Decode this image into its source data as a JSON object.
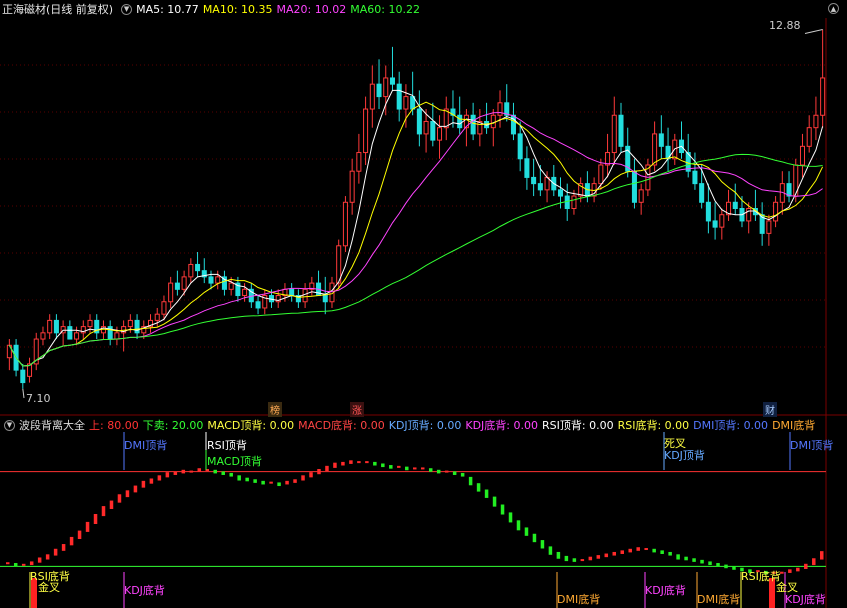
{
  "header": {
    "title": "正海磁材(日线 前复权)",
    "ma_items": [
      {
        "label": "MA5: 10.77",
        "color": "#ffffff"
      },
      {
        "label": "MA10: 10.35",
        "color": "#ffff00"
      },
      {
        "label": "MA20: 10.02",
        "color": "#ff44ff"
      },
      {
        "label": "MA60: 10.22",
        "color": "#33ff33"
      }
    ]
  },
  "price_panel": {
    "high_label": "12.88",
    "low_label": "7.10",
    "event_tags": [
      {
        "text": "榜",
        "color": "#ffaa55"
      },
      {
        "text": "涨",
        "color": "#ff5555"
      },
      {
        "text": "财",
        "color": "#aaccff"
      }
    ]
  },
  "indicator_header": {
    "name": "波段背离大全",
    "items": [
      {
        "label": "上: 80.00",
        "color": "#ff3333"
      },
      {
        "label": "下卖: 20.00",
        "color": "#33ff33"
      },
      {
        "label": "MACD顶背: 0.00",
        "color": "#ffff44"
      },
      {
        "label": "MACD底背: 0.00",
        "color": "#ff4444"
      },
      {
        "label": "KDJ顶背: 0.00",
        "color": "#66aaff"
      },
      {
        "label": "KDJ底背: 0.00",
        "color": "#ff44ff"
      },
      {
        "label": "RSI顶背: 0.00",
        "color": "#ffffff"
      },
      {
        "label": "RSI底背: 0.00",
        "color": "#ffff44"
      },
      {
        "label": "DMI顶背: 0.00",
        "color": "#5577ff"
      },
      {
        "label": "DMI底背",
        "color": "#ffaa33"
      }
    ]
  },
  "signals": {
    "dmi_top_1": "DMI顶背",
    "rsi_top": "RSI顶背",
    "macd_top": "MACD顶背",
    "dead_cross": "死叉",
    "kdj_top": "KDJ顶背",
    "dmi_top_2": "DMI顶背",
    "rsi_bottom_1": "RSI底背",
    "golden_cross_1": "金叉",
    "kdj_bottom_1": "KDJ底背",
    "dmi_bottom_1": "DMI底背",
    "kdj_bottom_2": "KDJ底背",
    "dmi_bottom_2": "DMI底背",
    "rsi_bottom_2": "RSI底背",
    "golden_cross_2": "金叉",
    "kdj_bottom_3": "KDJ底背"
  },
  "chart_data": {
    "type": "candlestick",
    "candles_ohlc": [
      [
        7.6,
        7.9,
        7.4,
        7.8
      ],
      [
        7.8,
        7.9,
        7.3,
        7.4
      ],
      [
        7.4,
        7.5,
        7.1,
        7.2
      ],
      [
        7.3,
        7.6,
        7.2,
        7.5
      ],
      [
        7.5,
        8.0,
        7.4,
        7.9
      ],
      [
        7.9,
        8.1,
        7.8,
        8.0
      ],
      [
        8.0,
        8.3,
        7.9,
        8.2
      ],
      [
        8.2,
        8.3,
        7.9,
        8.0
      ],
      [
        8.0,
        8.2,
        7.8,
        8.1
      ],
      [
        8.1,
        8.2,
        7.9,
        7.9
      ],
      [
        7.9,
        8.1,
        7.8,
        8.0
      ],
      [
        8.0,
        8.2,
        7.9,
        8.1
      ],
      [
        8.1,
        8.3,
        8.0,
        8.2
      ],
      [
        8.2,
        8.3,
        7.9,
        8.0
      ],
      [
        8.0,
        8.2,
        7.9,
        8.1
      ],
      [
        8.1,
        8.2,
        7.8,
        7.9
      ],
      [
        7.9,
        8.1,
        7.8,
        8.0
      ],
      [
        8.0,
        8.2,
        7.7,
        8.1
      ],
      [
        8.1,
        8.3,
        8.0,
        8.2
      ],
      [
        8.2,
        8.3,
        7.9,
        8.0
      ],
      [
        8.0,
        8.2,
        7.9,
        8.1
      ],
      [
        8.1,
        8.3,
        8.0,
        8.2
      ],
      [
        8.2,
        8.4,
        8.1,
        8.3
      ],
      [
        8.3,
        8.6,
        8.2,
        8.5
      ],
      [
        8.5,
        8.9,
        8.4,
        8.8
      ],
      [
        8.8,
        9.0,
        8.6,
        8.7
      ],
      [
        8.7,
        9.0,
        8.6,
        8.9
      ],
      [
        8.9,
        9.2,
        8.8,
        9.1
      ],
      [
        9.1,
        9.3,
        8.9,
        9.0
      ],
      [
        9.0,
        9.2,
        8.8,
        8.9
      ],
      [
        8.9,
        9.0,
        8.7,
        8.8
      ],
      [
        8.8,
        9.0,
        8.7,
        8.9
      ],
      [
        8.9,
        9.0,
        8.6,
        8.7
      ],
      [
        8.7,
        8.9,
        8.6,
        8.8
      ],
      [
        8.8,
        8.9,
        8.5,
        8.6
      ],
      [
        8.6,
        8.8,
        8.5,
        8.7
      ],
      [
        8.7,
        8.8,
        8.4,
        8.5
      ],
      [
        8.5,
        8.6,
        8.3,
        8.4
      ],
      [
        8.4,
        8.7,
        8.3,
        8.6
      ],
      [
        8.6,
        8.7,
        8.4,
        8.5
      ],
      [
        8.5,
        8.7,
        8.4,
        8.6
      ],
      [
        8.6,
        8.8,
        8.5,
        8.7
      ],
      [
        8.7,
        8.8,
        8.5,
        8.6
      ],
      [
        8.6,
        8.7,
        8.4,
        8.5
      ],
      [
        8.5,
        8.8,
        8.4,
        8.7
      ],
      [
        8.7,
        8.9,
        8.6,
        8.8
      ],
      [
        8.8,
        9.0,
        8.7,
        8.6
      ],
      [
        8.6,
        8.9,
        8.3,
        8.5
      ],
      [
        8.5,
        8.9,
        8.4,
        8.8
      ],
      [
        8.8,
        9.5,
        8.7,
        9.4
      ],
      [
        9.4,
        10.2,
        9.3,
        10.1
      ],
      [
        10.1,
        10.8,
        9.9,
        10.6
      ],
      [
        10.6,
        11.2,
        10.4,
        10.9
      ],
      [
        10.9,
        11.8,
        10.7,
        11.6
      ],
      [
        11.6,
        12.3,
        11.3,
        12.0
      ],
      [
        12.0,
        12.4,
        11.6,
        11.8
      ],
      [
        11.8,
        12.3,
        11.5,
        12.1
      ],
      [
        12.1,
        12.6,
        11.9,
        12.0
      ],
      [
        12.0,
        12.2,
        11.4,
        11.6
      ],
      [
        11.6,
        12.0,
        11.3,
        11.8
      ],
      [
        11.8,
        12.2,
        11.5,
        11.6
      ],
      [
        11.6,
        11.9,
        11.0,
        11.2
      ],
      [
        11.2,
        11.6,
        10.9,
        11.4
      ],
      [
        11.4,
        11.7,
        11.0,
        11.1
      ],
      [
        11.1,
        11.5,
        10.8,
        11.3
      ],
      [
        11.3,
        11.8,
        11.1,
        11.6
      ],
      [
        11.6,
        11.9,
        11.3,
        11.5
      ],
      [
        11.5,
        11.8,
        11.2,
        11.3
      ],
      [
        11.3,
        11.6,
        11.0,
        11.5
      ],
      [
        11.5,
        11.7,
        11.1,
        11.2
      ],
      [
        11.2,
        11.6,
        11.0,
        11.4
      ],
      [
        11.4,
        11.7,
        11.2,
        11.3
      ],
      [
        11.3,
        11.6,
        11.0,
        11.5
      ],
      [
        11.5,
        11.9,
        11.3,
        11.7
      ],
      [
        11.7,
        12.0,
        11.4,
        11.5
      ],
      [
        11.5,
        11.7,
        11.1,
        11.2
      ],
      [
        11.2,
        11.4,
        10.6,
        10.8
      ],
      [
        10.8,
        11.0,
        10.3,
        10.5
      ],
      [
        10.5,
        10.8,
        10.2,
        10.4
      ],
      [
        10.4,
        10.7,
        10.2,
        10.3
      ],
      [
        10.3,
        10.6,
        10.1,
        10.5
      ],
      [
        10.5,
        10.7,
        10.2,
        10.3
      ],
      [
        10.3,
        10.5,
        10.0,
        10.2
      ],
      [
        10.2,
        10.4,
        9.8,
        10.0
      ],
      [
        10.0,
        10.3,
        9.9,
        10.2
      ],
      [
        10.2,
        10.5,
        10.1,
        10.4
      ],
      [
        10.4,
        10.6,
        10.1,
        10.2
      ],
      [
        10.2,
        10.5,
        10.1,
        10.4
      ],
      [
        10.4,
        10.8,
        10.3,
        10.7
      ],
      [
        10.7,
        11.2,
        10.5,
        10.9
      ],
      [
        10.9,
        11.8,
        10.7,
        11.5
      ],
      [
        11.5,
        11.7,
        10.9,
        11.0
      ],
      [
        11.0,
        11.3,
        10.5,
        10.6
      ],
      [
        10.6,
        10.8,
        10.0,
        10.1
      ],
      [
        10.1,
        10.4,
        9.9,
        10.3
      ],
      [
        10.3,
        10.8,
        10.2,
        10.7
      ],
      [
        10.7,
        11.4,
        10.6,
        11.2
      ],
      [
        11.2,
        11.5,
        10.8,
        11.0
      ],
      [
        11.0,
        11.3,
        10.6,
        10.8
      ],
      [
        10.8,
        11.2,
        10.7,
        11.1
      ],
      [
        11.1,
        11.4,
        10.8,
        10.9
      ],
      [
        10.9,
        11.2,
        10.5,
        10.6
      ],
      [
        10.6,
        10.9,
        10.3,
        10.4
      ],
      [
        10.4,
        10.7,
        10.0,
        10.1
      ],
      [
        10.1,
        10.4,
        9.6,
        9.8
      ],
      [
        9.8,
        10.1,
        9.5,
        9.7
      ],
      [
        9.7,
        10.0,
        9.5,
        9.9
      ],
      [
        9.9,
        10.3,
        9.8,
        10.1
      ],
      [
        10.1,
        10.4,
        9.9,
        10.0
      ],
      [
        10.0,
        10.2,
        9.7,
        9.8
      ],
      [
        9.8,
        10.1,
        9.6,
        10.0
      ],
      [
        10.0,
        10.3,
        9.8,
        9.9
      ],
      [
        9.9,
        10.1,
        9.4,
        9.6
      ],
      [
        9.6,
        9.9,
        9.4,
        9.8
      ],
      [
        9.8,
        10.2,
        9.7,
        10.1
      ],
      [
        10.1,
        10.6,
        9.9,
        10.4
      ],
      [
        10.4,
        10.6,
        10.1,
        10.2
      ],
      [
        10.2,
        10.8,
        10.1,
        10.7
      ],
      [
        10.7,
        11.2,
        10.5,
        11.0
      ],
      [
        11.0,
        11.5,
        10.9,
        11.3
      ],
      [
        11.3,
        11.8,
        11.1,
        11.5
      ],
      [
        11.5,
        12.88,
        11.3,
        12.1
      ]
    ],
    "osc_values": [
      22,
      21,
      21,
      22,
      24,
      26,
      29,
      32,
      36,
      40,
      45,
      50,
      55,
      59,
      63,
      66,
      69,
      72,
      74,
      76,
      78,
      79,
      80,
      80,
      81,
      81,
      80,
      79,
      78,
      76,
      75,
      74,
      73,
      73,
      72,
      73,
      74,
      76,
      78,
      80,
      82,
      84,
      85,
      86,
      86,
      86,
      85,
      84,
      83,
      83,
      82,
      82,
      82,
      81,
      80,
      80,
      79,
      78,
      74,
      70,
      66,
      61,
      56,
      51,
      46,
      42,
      38,
      34,
      30,
      27,
      25,
      24,
      24,
      25,
      26,
      27,
      28,
      29,
      30,
      31,
      31,
      30,
      29,
      28,
      26,
      25,
      24,
      23,
      22,
      21,
      20,
      19,
      18,
      17,
      17,
      16,
      16,
      16,
      17,
      18,
      20,
      23,
      27
    ],
    "osc_range": [
      0,
      100
    ],
    "overbought": 80,
    "oversold": 20
  }
}
